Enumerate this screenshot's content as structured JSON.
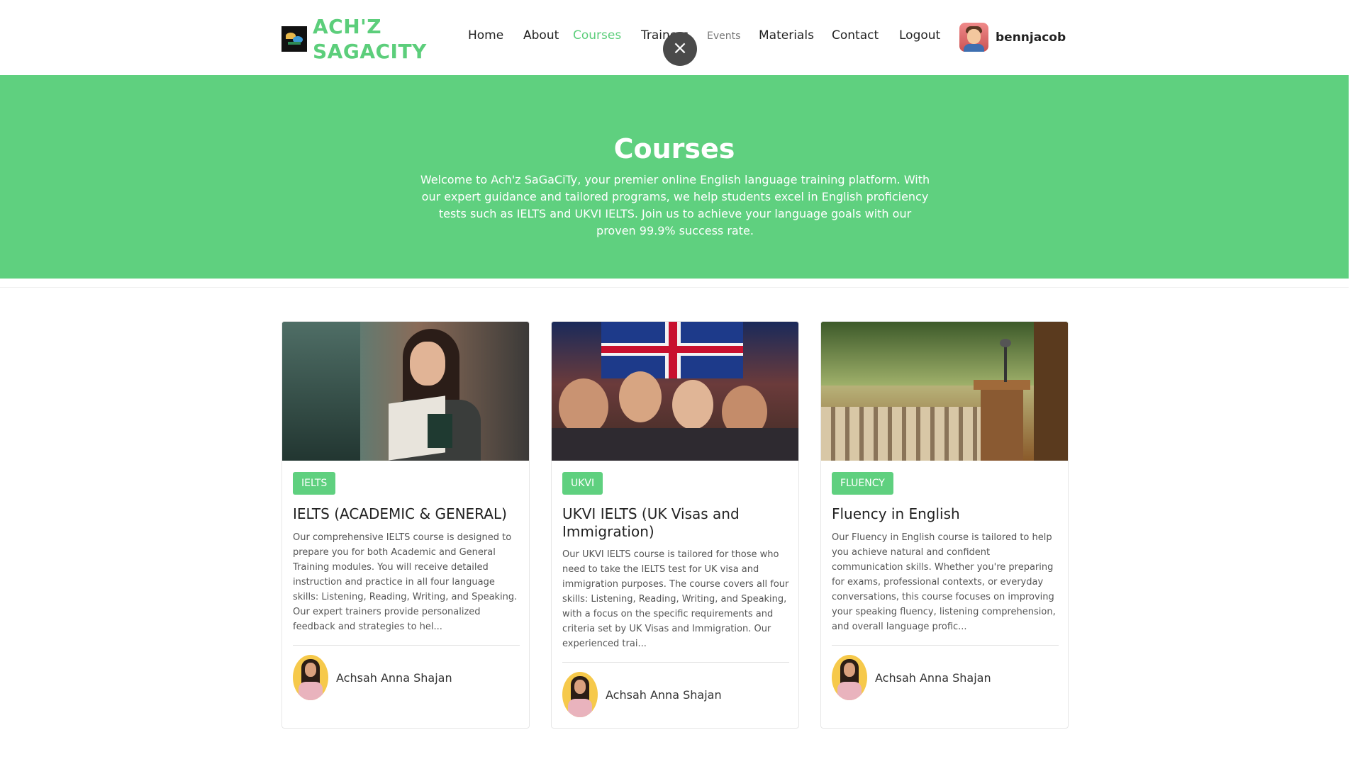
{
  "header": {
    "logo_line1": "ACH'Z",
    "logo_line2": "SAGACITY",
    "nav": {
      "home": "Home",
      "about": "About",
      "courses": "Courses",
      "trainers": "Trainers",
      "events": "Events",
      "materials": "Materials",
      "contact": "Contact",
      "logout": "Logout"
    },
    "username": "bennjacob",
    "close_glyph": "×"
  },
  "hero": {
    "title": "Courses",
    "text": "Welcome to Ach'z SaGaCiTy, your premier online English language training platform. With our expert guidance and tailored programs, we help students excel in English proficiency tests such as IELTS and UKVI IELTS. Join us to achieve your language goals with our proven 99.9% success rate."
  },
  "courses": [
    {
      "badge": "IELTS",
      "title": "IELTS (ACADEMIC & GENERAL)",
      "description": "Our comprehensive IELTS course is designed to prepare you for both Academic and General Training modules. You will receive detailed instruction and practice in all four language skills: Listening, Reading, Writing, and Speaking. Our expert trainers provide personalized feedback and strategies to hel...",
      "trainer": "Achsah Anna Shajan"
    },
    {
      "badge": "UKVI",
      "title": "UKVI IELTS (UK Visas and Immigration)",
      "description": "Our UKVI IELTS course is tailored for those who need to take the IELTS test for UK visa and immigration purposes. The course covers all four skills: Listening, Reading, Writing, and Speaking, with a focus on the specific requirements and criteria set by UK Visas and Immigration. Our experienced trai...",
      "trainer": "Achsah Anna Shajan"
    },
    {
      "badge": "FLUENCY",
      "title": "Fluency in English",
      "description": "Our Fluency in English course is tailored to help you achieve natural and confident communication skills. Whether you're preparing for exams, professional contexts, or everyday conversations, this course focuses on improving your speaking fluency, listening comprehension, and overall language profic...",
      "trainer": "Achsah Anna Shajan"
    }
  ],
  "colors": {
    "accent": "#5fd07f",
    "text": "#222222"
  },
  "icons": {
    "logo": "site-logo",
    "close": "close-icon",
    "avatar": "user-avatar"
  }
}
